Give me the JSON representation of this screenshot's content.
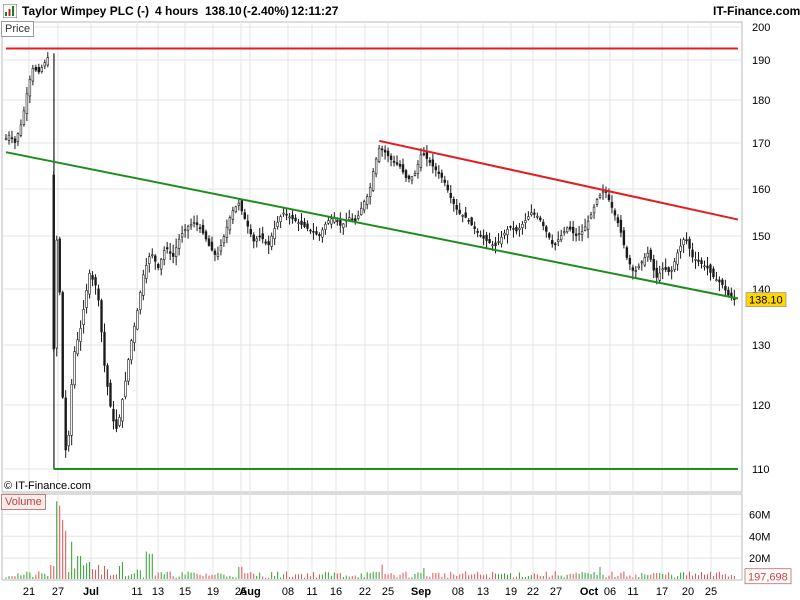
{
  "header": {
    "title": "Taylor Wimpey PLC (-)",
    "timeframe": "4 hours",
    "price": "138.10",
    "change": "(-2.40%)",
    "time": "12:11:27",
    "brand": "IT-Finance.com"
  },
  "panels": {
    "price_label": "Price",
    "volume_label": "Volume",
    "watermark": "© IT-Finance.com"
  },
  "colors": {
    "candle": "#1a1a1a",
    "up_body": "#ffffff",
    "down_body": "#1a1a1a",
    "support": "#1e8c1e",
    "resistance": "#e02020",
    "volume_up": "#2ca02c",
    "volume_down": "#e05050",
    "grid": "#e4e4e4",
    "last_price_badge": "#ffd700"
  },
  "chart_data": [
    {
      "type": "candlestick",
      "title": "Taylor Wimpey PLC (-)",
      "ylabel": "Price",
      "ylim": [
        107,
        202
      ],
      "y_scale": "log",
      "y_ticks": [
        110,
        120,
        130,
        140,
        150,
        160,
        170,
        180,
        190,
        200
      ],
      "x_ticks": [
        "21",
        "27",
        "Jul",
        "11",
        "13",
        "15",
        "19",
        "25",
        "Aug",
        "08",
        "11",
        "16",
        "22",
        "25",
        "Sep",
        "08",
        "13",
        "19",
        "22",
        "27",
        "Oct",
        "06",
        "11",
        "17",
        "20",
        "25"
      ],
      "last_price": "138.10",
      "grid": true,
      "lines": [
        {
          "name": "",
          "kind": "resistance",
          "from": [
            0,
            193.5
          ],
          "to": [
            100,
            193.5
          ]
        },
        {
          "name": "",
          "kind": "support",
          "from": [
            0,
            168
          ],
          "to": [
            100,
            138.3
          ]
        },
        {
          "name": "",
          "kind": "resistance",
          "from": [
            51,
            170.5
          ],
          "to": [
            100,
            153.5
          ]
        },
        {
          "name": "",
          "kind": "support",
          "from": [
            6.5,
            110
          ],
          "to": [
            100,
            110
          ]
        }
      ],
      "close_path": [
        [
          0,
          171
        ],
        [
          0.5,
          172
        ],
        [
          1.2,
          170
        ],
        [
          2.2,
          175
        ],
        [
          3,
          183
        ],
        [
          3.6,
          188
        ],
        [
          4.5,
          187
        ],
        [
          5.2,
          189
        ],
        [
          5.8,
          191
        ],
        [
          6.5,
          128
        ],
        [
          6.9,
          150
        ],
        [
          7.4,
          138
        ],
        [
          7.9,
          114
        ],
        [
          8.4,
          112
        ],
        [
          9.2,
          128
        ],
        [
          10.2,
          133
        ],
        [
          11.4,
          143
        ],
        [
          12.5,
          140
        ],
        [
          13.5,
          126
        ],
        [
          14.5,
          118
        ],
        [
          15.2,
          116
        ],
        [
          16.2,
          123
        ],
        [
          17,
          130
        ],
        [
          17.8,
          135
        ],
        [
          18.8,
          143
        ],
        [
          19.8,
          147
        ],
        [
          20.8,
          144
        ],
        [
          21.8,
          148
        ],
        [
          22.8,
          146
        ],
        [
          23.8,
          150
        ],
        [
          24.8,
          152
        ],
        [
          25.8,
          153
        ],
        [
          26.8,
          151
        ],
        [
          27.8,
          148
        ],
        [
          28.8,
          146
        ],
        [
          29.8,
          150
        ],
        [
          30.8,
          155
        ],
        [
          31.8,
          157
        ],
        [
          32.8,
          153
        ],
        [
          33.8,
          149
        ],
        [
          34.8,
          150
        ],
        [
          35.8,
          148
        ],
        [
          36.8,
          152
        ],
        [
          37.8,
          155
        ],
        [
          38.8,
          154
        ],
        [
          39.8,
          153
        ],
        [
          40.8,
          152
        ],
        [
          41.8,
          151
        ],
        [
          42.8,
          150
        ],
        [
          43.8,
          153
        ],
        [
          44.8,
          154
        ],
        [
          45.8,
          152
        ],
        [
          46.8,
          154
        ],
        [
          47.8,
          153
        ],
        [
          48.8,
          157
        ],
        [
          49.6,
          159
        ],
        [
          50.3,
          165
        ],
        [
          51,
          169
        ],
        [
          51.8,
          168
        ],
        [
          52.8,
          166
        ],
        [
          53.8,
          165
        ],
        [
          54.8,
          162
        ],
        [
          55.8,
          163
        ],
        [
          56.8,
          168
        ],
        [
          57.8,
          166
        ],
        [
          58.8,
          164
        ],
        [
          59.8,
          162
        ],
        [
          60.8,
          158
        ],
        [
          61.8,
          155
        ],
        [
          62.8,
          154
        ],
        [
          63.8,
          152
        ],
        [
          64.8,
          150
        ],
        [
          65.8,
          149
        ],
        [
          66.8,
          148
        ],
        [
          67.8,
          150
        ],
        [
          68.8,
          152
        ],
        [
          69.8,
          151
        ],
        [
          70.8,
          153
        ],
        [
          71.8,
          155
        ],
        [
          72.8,
          154
        ],
        [
          73.8,
          151
        ],
        [
          74.8,
          148
        ],
        [
          75.8,
          150
        ],
        [
          76.8,
          152
        ],
        [
          77.8,
          150
        ],
        [
          78.8,
          151
        ],
        [
          79.8,
          154
        ],
        [
          80.8,
          158
        ],
        [
          81.8,
          160
        ],
        [
          82.8,
          156
        ],
        [
          83.8,
          152
        ],
        [
          84.8,
          146
        ],
        [
          85.8,
          143
        ],
        [
          86.8,
          145
        ],
        [
          87.8,
          147
        ],
        [
          88.8,
          142
        ],
        [
          89.8,
          144
        ],
        [
          90.8,
          143
        ],
        [
          91.8,
          147
        ],
        [
          92.8,
          150
        ],
        [
          93.8,
          146
        ],
        [
          94.8,
          145
        ],
        [
          95.8,
          144
        ],
        [
          96.8,
          142
        ],
        [
          97.8,
          141
        ],
        [
          98.6,
          139
        ],
        [
          99.5,
          138.1
        ]
      ]
    },
    {
      "type": "bar",
      "title": "Volume",
      "ylim": [
        0,
        75
      ],
      "y_ticks": [
        "20M",
        "40M",
        "60M"
      ],
      "last_value": "197,698",
      "spikes": [
        {
          "x": 6.8,
          "value": 72
        },
        {
          "x": 7.3,
          "value": 68
        },
        {
          "x": 7.8,
          "value": 55
        },
        {
          "x": 8.3,
          "value": 45
        },
        {
          "x": 9.0,
          "value": 35
        },
        {
          "x": 10.0,
          "value": 22
        },
        {
          "x": 19.3,
          "value": 26
        },
        {
          "x": 19.8,
          "value": 24
        },
        {
          "x": 32.0,
          "value": 12
        },
        {
          "x": 51.5,
          "value": 14
        },
        {
          "x": 57.0,
          "value": 11
        },
        {
          "x": 81.0,
          "value": 12
        }
      ]
    }
  ]
}
